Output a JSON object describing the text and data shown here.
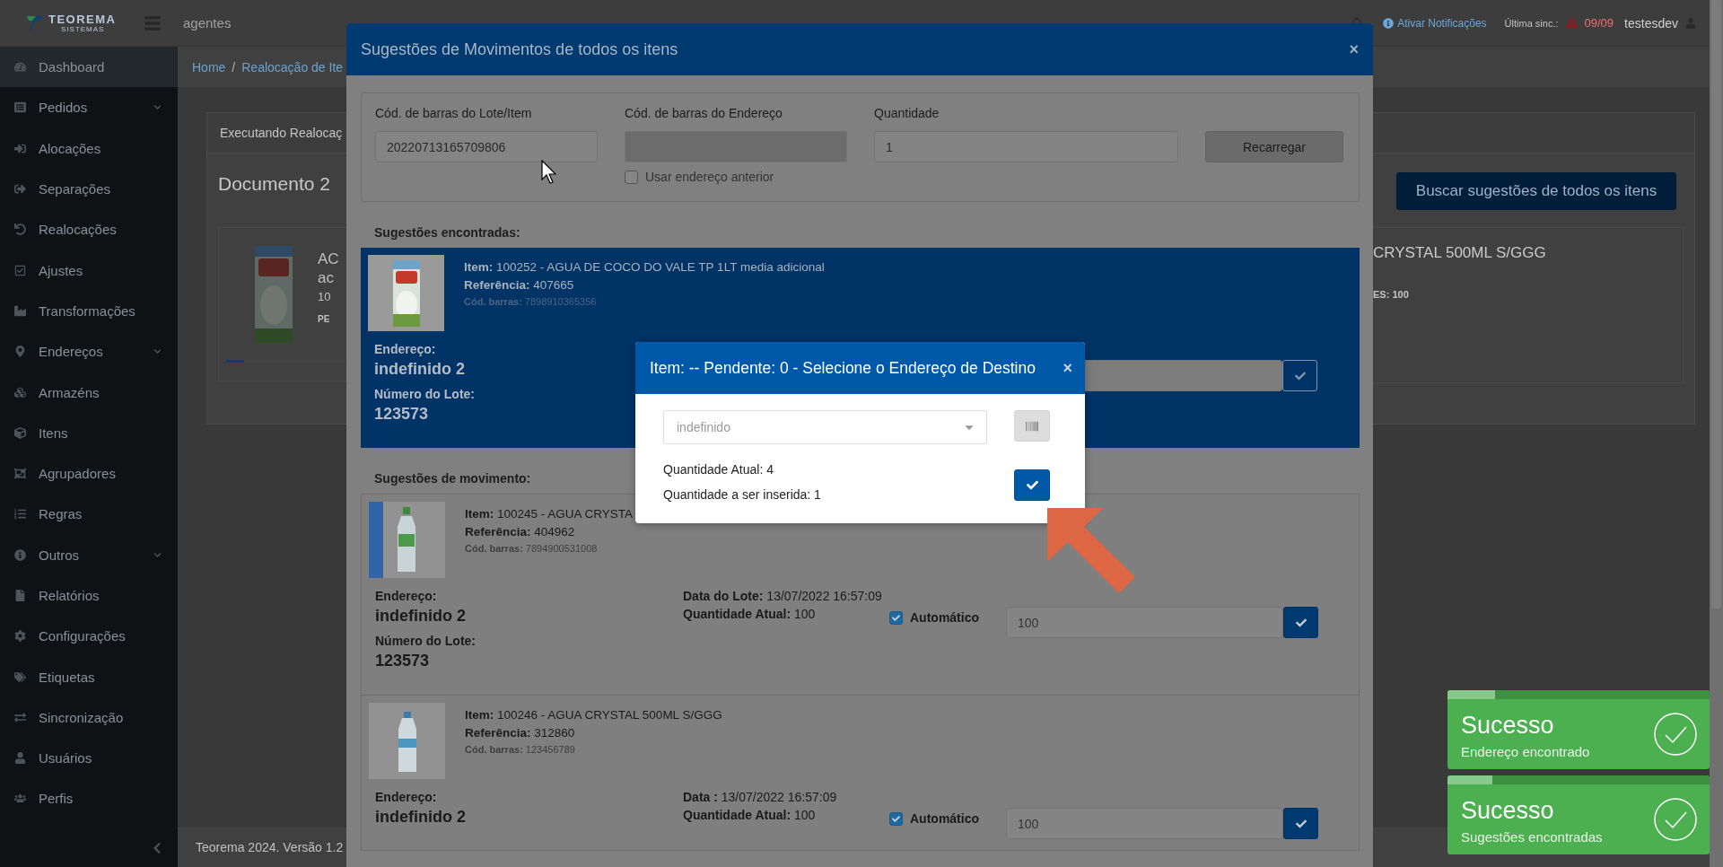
{
  "header": {
    "logo": "TEOREMA",
    "logo_sub": "SISTEMAS",
    "context": "agentes",
    "notifications_link": "Ativar Notificações",
    "sync_label": "Última sinc.:",
    "sync_warning": true,
    "sync_value": "09/09",
    "user": "testesdev"
  },
  "sidebar": {
    "items": [
      {
        "label": "Dashboard",
        "selected": true,
        "expandable": false
      },
      {
        "label": "Pedidos",
        "selected": false,
        "expandable": true
      },
      {
        "label": "Alocações",
        "selected": false,
        "expandable": false
      },
      {
        "label": "Separações",
        "selected": false,
        "expandable": false
      },
      {
        "label": "Realocações",
        "selected": false,
        "expandable": false
      },
      {
        "label": "Ajustes",
        "selected": false,
        "expandable": false
      },
      {
        "label": "Transformações",
        "selected": false,
        "expandable": false
      },
      {
        "label": "Endereços",
        "selected": false,
        "expandable": true
      },
      {
        "label": "Armazéns",
        "selected": false,
        "expandable": false
      },
      {
        "label": "Itens",
        "selected": false,
        "expandable": false
      },
      {
        "label": "Agrupadores",
        "selected": false,
        "expandable": false
      },
      {
        "label": "Regras",
        "selected": false,
        "expandable": false
      },
      {
        "label": "Outros",
        "selected": false,
        "expandable": true
      },
      {
        "label": "Relatórios",
        "selected": false,
        "expandable": false
      },
      {
        "label": "Configurações",
        "selected": false,
        "expandable": false
      },
      {
        "label": "Etiquetas",
        "selected": false,
        "expandable": false
      },
      {
        "label": "Sincronização",
        "selected": false,
        "expandable": false
      },
      {
        "label": "Usuários",
        "selected": false,
        "expandable": false
      },
      {
        "label": "Perfis",
        "selected": false,
        "expandable": false
      }
    ]
  },
  "breadcrumb": {
    "items": [
      "Home",
      "Realocação de Ite"
    ],
    "separator": "/"
  },
  "page": {
    "card_title": "Executando Realocaç",
    "document": "Documento 2",
    "product_lines": [
      "AC",
      "ac",
      "10",
      "PE"
    ],
    "product_progress": {
      "level": 0.15
    },
    "search_button": "Buscar sugestões de todos os itens",
    "right_item_title": "CRYSTAL 500ML S/GGG",
    "right_item_meta": "ES: 100"
  },
  "footer": "Teorema 2024. Versão 1.2",
  "modal": {
    "title": "Sugestões de Movimentos de todos os itens",
    "close": "×",
    "fields": [
      {
        "label": "Cód. de barras do Lote/Item",
        "value": "20220713165709806",
        "disabled": false
      },
      {
        "label": "Cód. de barras do Endereço",
        "disabled": true
      },
      {
        "label": "Quantidade",
        "value": "1",
        "disabled": false
      }
    ],
    "previous_address": {
      "label": "Usar endereço anterior",
      "checked": false
    },
    "reload_button": "Recarregar",
    "found_heading": "Sugestões encontradas:",
    "found": [
      {
        "selected": true,
        "item": "**Item:** 100252 - AGUA DE COCO DO VALE TP 1LT media adicional",
        "reference": "**Referência:** 407665",
        "barcode": "**Cód. barras:** 7898910365356",
        "address_label": "Endereço:",
        "address": "indefinido 2",
        "lot_label": "Número do Lote:",
        "lot": "123573"
      }
    ],
    "movements_heading": "Sugestões de movimento:",
    "movements": [
      {
        "selected": false,
        "item": "**Item:** 100245 - AGUA CRYSTA",
        "reference": "**Referência:** 404962",
        "barcode": "**Cód. barras:** 7894900531008",
        "address_label": "Endereço:",
        "address": "indefinido 2",
        "lot_label": "Número do Lote:",
        "lot": "123573",
        "date": "**Data do Lote:** 13/07/2022 16:57:09",
        "quantity": "**Quantidade Atual:** 100",
        "automatic": {
          "label": "Automático",
          "checked": true
        },
        "amount": "100"
      },
      {
        "selected": false,
        "item": "**Item:** 100246 - AGUA CRYSTAL 500ML S/GGG",
        "reference": "**Referência:** 312860",
        "barcode": "**Cód. barras:** 123456789",
        "address_label": "Endereço:",
        "address": "indefinido 2",
        "date": "**Data :** 13/07/2022 16:57:09",
        "quantity": "**Quantidade Atual:** 100",
        "automatic": {
          "label": "Automático",
          "checked": true
        },
        "amount": "100"
      }
    ]
  },
  "dialog": {
    "title": "Item: -- Pendente: 0 - Selecione o Endereço de Destino",
    "close": "×",
    "select": {
      "value": "indefinido"
    },
    "lines": [
      "Quantidade Atual: 4",
      "Quantidade a ser inserida: 1"
    ]
  },
  "toasts": [
    {
      "title": "Sucesso",
      "message": "Endereço encontrado",
      "level": 0.18
    },
    {
      "title": "Sucesso",
      "message": "Sugestões encontradas",
      "level": 0.17
    }
  ]
}
